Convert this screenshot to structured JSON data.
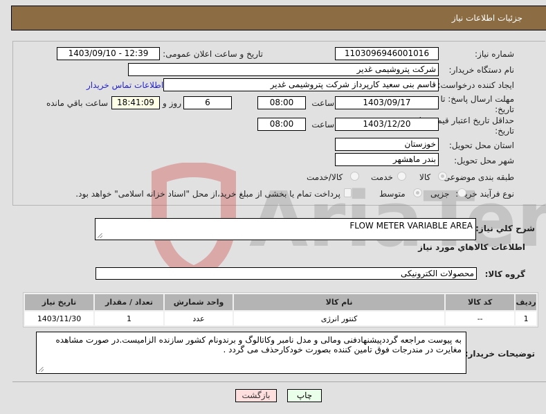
{
  "header": {
    "title": "جزئیات اطلاعات نیاز"
  },
  "form": {
    "need_number_label": "شماره نیاز:",
    "need_number": "1103096946001016",
    "announce_label": "تاریخ و ساعت اعلان عمومی:",
    "announce_value": "1403/09/10 - 12:39",
    "buyer_org_label": "نام دستگاه خریدار:",
    "buyer_org": "شرکت پتروشیمی غدیر",
    "requester_label": "ایجاد کننده درخواست:",
    "requester": "قاسم بنی سعید کارپرداز شرکت پتروشیمی غدیر",
    "buyer_contact_link": "اطلاعات تماس خریدار",
    "deadline_label": "مهلت ارسال پاسخ: تا تاریخ:",
    "deadline_date": "1403/09/17",
    "time_label": "ساعت",
    "deadline_time": "08:00",
    "days_value": "6",
    "days_label": "روز و",
    "remaining_time": "18:41:09",
    "remaining_label": "ساعت باقي مانده",
    "validity_label": "حداقل تاریخ اعتبار قیمت: تا تاریخ:",
    "validity_date": "1403/12/20",
    "validity_time": "08:00",
    "province_label": "استان محل تحویل:",
    "province": "خوزستان",
    "city_label": "شهر محل تحویل:",
    "city": "بندر ماهشهر",
    "category_label": "طبقه بندی موضوعی:",
    "category_options": [
      {
        "label": "کالا",
        "selected": true
      },
      {
        "label": "خدمت",
        "selected": false
      },
      {
        "label": "کالا/خدمت",
        "selected": false
      }
    ],
    "process_label": "نوع فرآیند خرید :",
    "process_options": [
      {
        "label": "جزیی",
        "selected": false
      },
      {
        "label": "متوسط",
        "selected": true
      }
    ],
    "payment_note": "پرداخت تمام یا بخشی از مبلغ خرید،از محل \"اسناد خزانه اسلامی\" خواهد بود."
  },
  "description": {
    "label": "شرح كلي نياز:",
    "value": "FLOW METER VARIABLE AREA"
  },
  "goods_section": {
    "title": "اطلاعات كالاهاي مورد نياز",
    "group_label": "گروه کالا:",
    "group_value": "محصولات الکترونیکی"
  },
  "table": {
    "headers": [
      "ردیف",
      "کد کالا",
      "نام کالا",
      "واحد شمارش",
      "تعداد / مقدار",
      "تاریخ نیاز"
    ],
    "rows": [
      [
        "1",
        "--",
        "کنتور انرژی",
        "عدد",
        "1",
        "1403/11/30"
      ]
    ]
  },
  "buyer_notes": {
    "label": "توضیحات خریدار:",
    "value": "به پیوست مراجعه گرددپیشنهادفنی ومالی و مدل نامبر وکاتالوگ و برندونام کشور سازنده الزامیست.در صورت مشاهده مغایرت در مندرجات فوق تامین کننده بصورت خودکارحذف می گردد ."
  },
  "buttons": {
    "print": "چاپ",
    "back": "بازگشت"
  },
  "watermark": {
    "text": "AriaTender.net"
  }
}
